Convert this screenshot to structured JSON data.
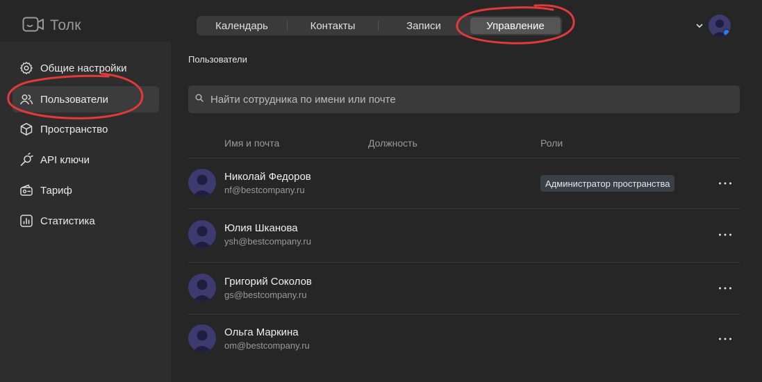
{
  "app": {
    "name": "Толк"
  },
  "nav": {
    "tabs": [
      {
        "label": "Календарь"
      },
      {
        "label": "Контакты"
      },
      {
        "label": "Записи"
      },
      {
        "label": "Управление",
        "active": true
      }
    ]
  },
  "sidebar": {
    "items": [
      {
        "label": "Общие настройки",
        "icon": "gear-icon"
      },
      {
        "label": "Пользователи",
        "icon": "users-icon",
        "active": true
      },
      {
        "label": "Пространство",
        "icon": "cube-icon"
      },
      {
        "label": "API ключи",
        "icon": "api-plug-icon"
      },
      {
        "label": "Тариф",
        "icon": "wallet-icon"
      },
      {
        "label": "Статистика",
        "icon": "chart-icon"
      }
    ]
  },
  "main": {
    "title": "Пользователи",
    "search": {
      "placeholder": "Найти сотрудника по имени или почте",
      "value": ""
    },
    "columns": [
      "Имя и почта",
      "Должность",
      "Роли"
    ],
    "users": [
      {
        "name": "Николай Федоров",
        "email": "nf@bestcompany.ru",
        "role": "Администратор пространства"
      },
      {
        "name": "Юлия Шканова",
        "email": "ysh@bestcompany.ru",
        "role": ""
      },
      {
        "name": "Григорий Соколов",
        "email": "gs@bestcompany.ru",
        "role": ""
      },
      {
        "name": "Ольга Маркина",
        "email": "om@bestcompany.ru",
        "role": ""
      }
    ]
  },
  "colors": {
    "background": "#262626",
    "sidebar": "#2d2d2d",
    "avatar": "#3d3b6e",
    "annotation": "#e03a3a",
    "status": "#2b7bff"
  }
}
